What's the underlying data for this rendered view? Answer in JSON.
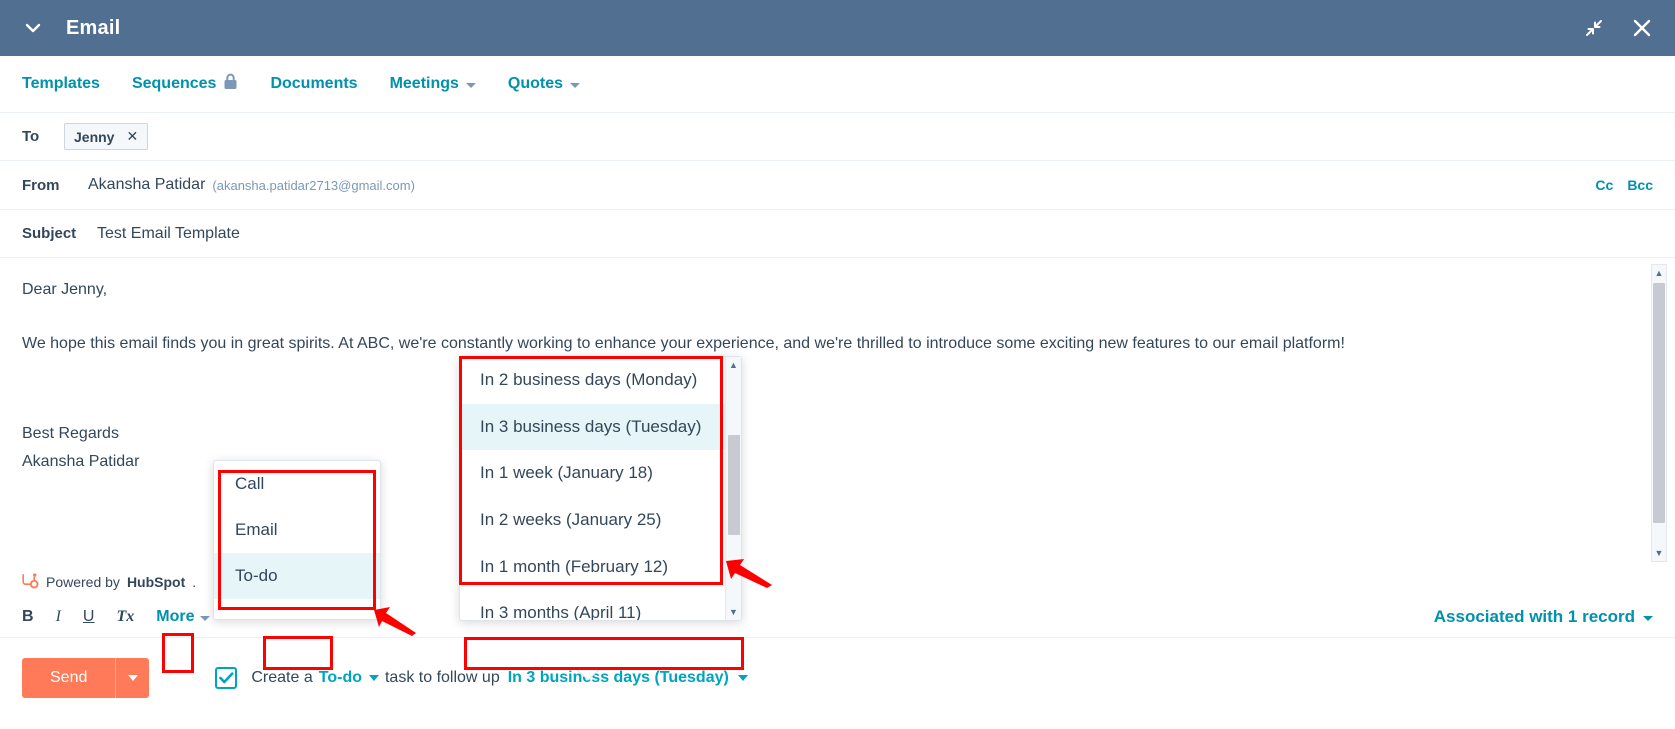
{
  "window": {
    "title": "Email",
    "chevron_icon": "chevron-down-icon",
    "minimize_icon": "minimize-icon",
    "close_icon": "close-icon"
  },
  "nav": {
    "items": [
      {
        "label": "Templates",
        "has_caret": false,
        "has_lock": false
      },
      {
        "label": "Sequences",
        "has_caret": false,
        "has_lock": true
      },
      {
        "label": "Documents",
        "has_caret": false,
        "has_lock": false
      },
      {
        "label": "Meetings",
        "has_caret": true,
        "has_lock": false
      },
      {
        "label": "Quotes",
        "has_caret": true,
        "has_lock": false
      }
    ]
  },
  "fields": {
    "to": {
      "label": "To",
      "chip": "Jenny",
      "chip_remove": "✕"
    },
    "from": {
      "label": "From",
      "name": "Akansha Patidar",
      "email": "(akansha.patidar2713@gmail.com)",
      "cc": "Cc",
      "bcc": "Bcc"
    },
    "subject": {
      "label": "Subject",
      "value": "Test Email Template"
    }
  },
  "body": {
    "greeting": "Dear Jenny,",
    "paragraph": "We hope this email finds you in great spirits. At ABC, we're constantly working to enhance your experience, and we're thrilled to introduce some exciting new features to our email platform!",
    "signoff": "Best Regards",
    "signature": "Akansha Patidar"
  },
  "powered_by": {
    "prefix": "Powered by",
    "brand": "HubSpot",
    "suffix": "."
  },
  "format_toolbar": {
    "bold": "B",
    "italic": "I",
    "underline": "U",
    "clear_format": "Tx",
    "more": "More",
    "associated": "Associated with 1 record"
  },
  "bottom": {
    "send": "Send",
    "create_prefix": "Create a",
    "task_type": "To-do",
    "create_suffix": "task to follow up",
    "due_date": "In 3 business days (Tuesday)",
    "checkbox_checked": true
  },
  "task_dropdown": {
    "options": [
      {
        "label": "Call",
        "selected": false
      },
      {
        "label": "Email",
        "selected": false
      },
      {
        "label": "To-do",
        "selected": true
      }
    ]
  },
  "date_dropdown": {
    "options": [
      {
        "label": "In 2 business days (Monday)",
        "selected": false
      },
      {
        "label": "In 3 business days (Tuesday)",
        "selected": true
      },
      {
        "label": "In 1 week (January 18)",
        "selected": false
      },
      {
        "label": "In 2 weeks (January 25)",
        "selected": false
      },
      {
        "label": "In 1 month (February 12)",
        "selected": false
      },
      {
        "label": "In 3 months (April 11)",
        "selected": false
      }
    ],
    "scroll_up": "▲",
    "scroll_down": "▼"
  },
  "colors": {
    "titlebar": "#516f90",
    "teal": "#0091ae",
    "teal_bright": "#00a4bd",
    "orange": "#ff7a59",
    "highlight_box": "#ff0000",
    "selected_row": "#e5f5f8"
  }
}
